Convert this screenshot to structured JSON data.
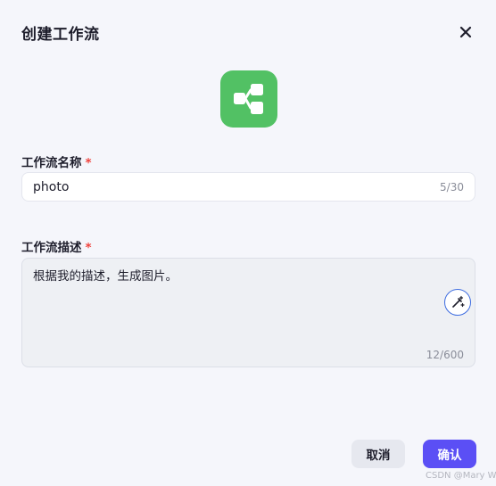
{
  "dialog": {
    "title": "创建工作流",
    "close_icon": "close-icon"
  },
  "logo": {
    "icon": "workflow-icon",
    "color": "#52c164"
  },
  "name_field": {
    "label": "工作流名称",
    "required_mark": "*",
    "value": "photo",
    "counter": "5/30"
  },
  "desc_field": {
    "label": "工作流描述",
    "required_mark": "*",
    "value": "根据我的描述，生成图片。",
    "counter": "12/600",
    "ai_icon": "magic-wand-icon"
  },
  "footer": {
    "cancel_label": "取消",
    "confirm_label": "确认"
  },
  "watermark": "CSDN @Mary W",
  "colors": {
    "accent": "#5b4ff5",
    "required": "#f0413b",
    "ai_border": "#3d6ce0"
  }
}
